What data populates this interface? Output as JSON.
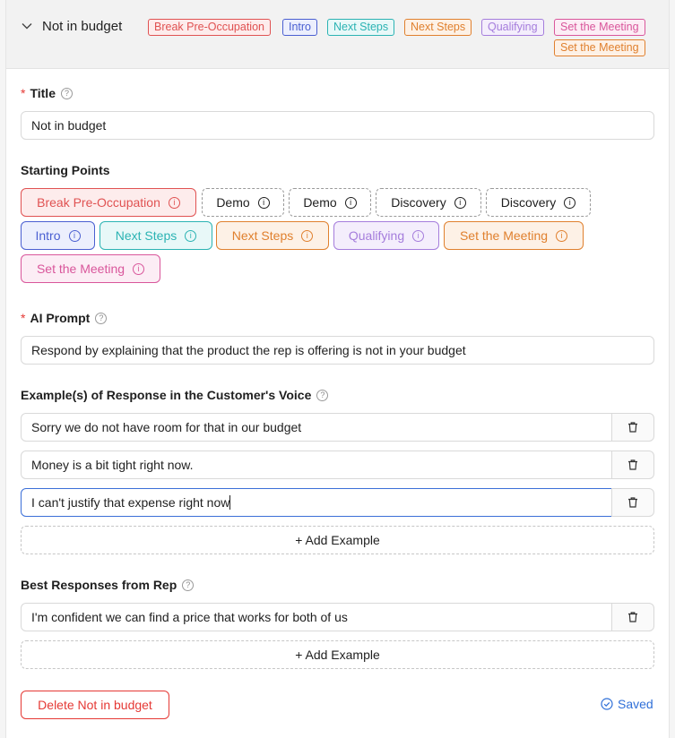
{
  "header": {
    "title": "Not in budget",
    "tags": [
      {
        "label": "Break Pre-Occupation",
        "color": "#e05252",
        "bg": "#fdecec"
      },
      {
        "label": "Intro",
        "color": "#4a5fd1",
        "bg": "#eceffd"
      },
      {
        "label": "Next Steps",
        "color": "#2bb3b3",
        "bg": "#e8f8f8"
      },
      {
        "label": "Next Steps",
        "color": "#e0802e",
        "bg": "#fdf1e6"
      },
      {
        "label": "Qualifying",
        "color": "#a57ddc",
        "bg": "#f4eefc"
      },
      {
        "label": "Set the Meeting",
        "color": "#d9569b",
        "bg": "#fcedf5"
      },
      {
        "label": "Set the Meeting",
        "color": "#e0802e",
        "bg": "#fdf1e6"
      }
    ]
  },
  "title_field": {
    "label": "Title",
    "value": "Not in budget"
  },
  "starting_points": {
    "label": "Starting Points",
    "items": [
      {
        "label": "Break Pre-Occupation",
        "color": "#e05252",
        "bg": "#fdecec",
        "selected": true
      },
      {
        "label": "Demo",
        "selected": false
      },
      {
        "label": "Demo",
        "selected": false
      },
      {
        "label": "Discovery",
        "selected": false
      },
      {
        "label": "Discovery",
        "selected": false
      },
      {
        "label": "Intro",
        "color": "#4a5fd1",
        "bg": "#eceffd",
        "selected": true
      },
      {
        "label": "Next Steps",
        "color": "#2bb3b3",
        "bg": "#e8f8f8",
        "selected": true
      },
      {
        "label": "Next Steps",
        "color": "#e0802e",
        "bg": "#fdf1e6",
        "selected": true
      },
      {
        "label": "Qualifying",
        "color": "#a57ddc",
        "bg": "#f4eefc",
        "selected": true
      },
      {
        "label": "Set the Meeting",
        "color": "#e0802e",
        "bg": "#fdf1e6",
        "selected": true
      },
      {
        "label": "Set the Meeting",
        "color": "#d9569b",
        "bg": "#fcedf5",
        "selected": true
      }
    ]
  },
  "ai_prompt": {
    "label": "AI Prompt",
    "value": "Respond by explaining that the product the rep is offering is not in your budget"
  },
  "customer_examples": {
    "label": "Example(s) of Response in the Customer's Voice",
    "items": [
      "Sorry we do not have room for that in our budget",
      "Money is a bit tight right now.",
      "I can't justify that expense right now"
    ],
    "add_label": "+ Add Example"
  },
  "rep_responses": {
    "label": "Best Responses from Rep",
    "items": [
      "I'm confident we can find a price that works for both of us"
    ],
    "add_label": "+ Add Example"
  },
  "footer": {
    "delete_label": "Delete Not in budget",
    "saved_label": "Saved"
  }
}
